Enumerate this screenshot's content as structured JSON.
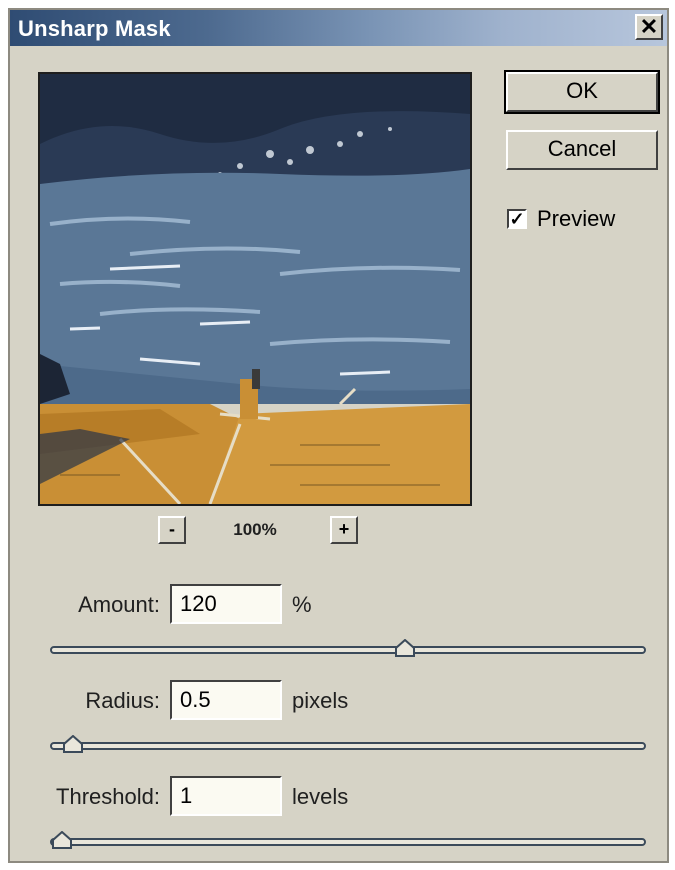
{
  "window": {
    "title": "Unsharp Mask",
    "close_glyph": "✕"
  },
  "buttons": {
    "ok": "OK",
    "cancel": "Cancel"
  },
  "preview_checkbox": {
    "label": "Preview",
    "checked": true,
    "mark": "✓"
  },
  "zoom": {
    "minus": "-",
    "plus": "+",
    "level": "100%"
  },
  "fields": {
    "amount": {
      "label": "Amount:",
      "value": "120",
      "unit": "%",
      "slider_fraction": 0.6
    },
    "radius": {
      "label": "Radius:",
      "value": "0.5",
      "unit": "pixels",
      "slider_fraction": 0.02
    },
    "threshold": {
      "label": "Threshold:",
      "value": "1",
      "unit": "levels",
      "slider_fraction": 0.0
    }
  },
  "colors": {
    "title_start": "#2f4c73",
    "dialog_bg": "#d6d3c6",
    "sea": "#5a7796",
    "roof": "#c98f35"
  },
  "icons": {
    "close": "close-icon",
    "check": "check-icon",
    "zoom_out": "minus-icon",
    "zoom_in": "plus-icon",
    "slider": "slider-thumb-icon"
  }
}
